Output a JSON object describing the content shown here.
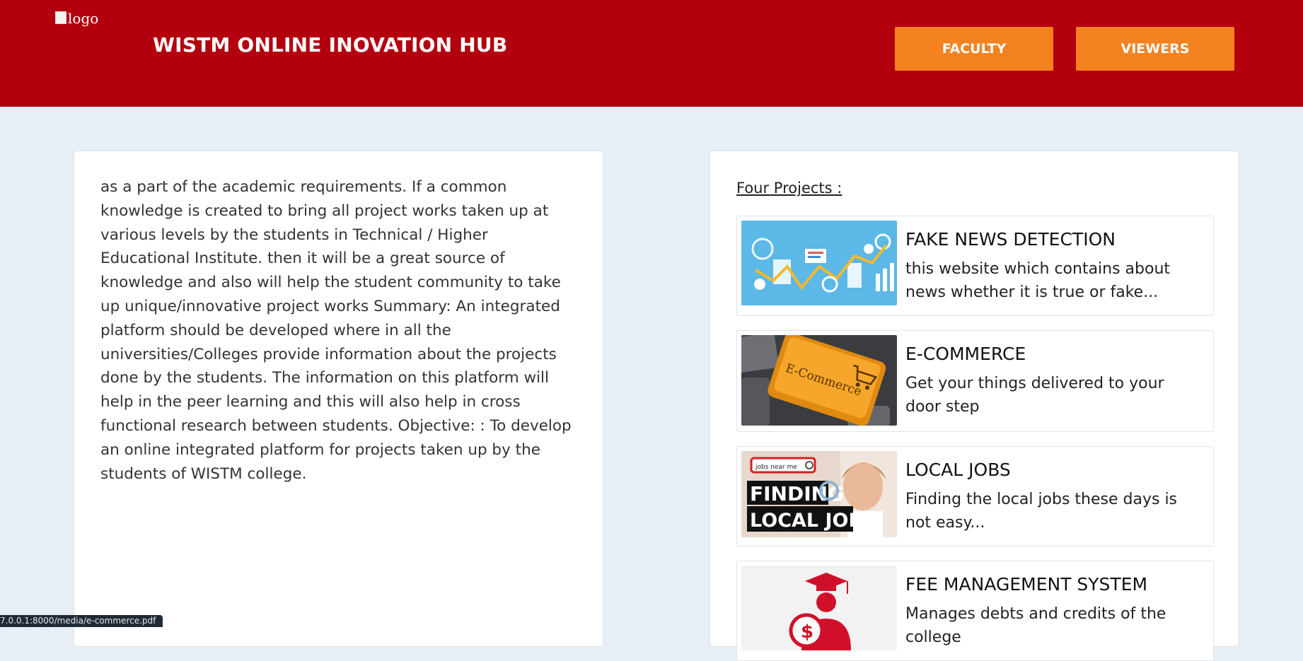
{
  "header": {
    "logo_alt": "logo",
    "title": "WISTM ONLINE INOVATION HUB",
    "nav": [
      {
        "label": "FACULTY"
      },
      {
        "label": "VIEWERS"
      }
    ],
    "bg_color": "#b3000f",
    "button_color": "#f58220"
  },
  "intro": {
    "text": "as a part of the academic requirements. If a common knowledge is created to bring all project works taken up at various levels by the students in Technical / Higher Educational Institute. then it will be a great source of knowledge and also will help the student community to take up unique/innovative project works Summary: An integrated platform should be developed where in all the universities/Colleges provide information about the projects done by the students. The information on this platform will help in the peer learning and this will also help in cross functional research between students. Objective: : To develop an online integrated platform for projects taken up by the students of WISTM college."
  },
  "projects": {
    "heading": "Four Projects :",
    "items": [
      {
        "title": "FAKE NEWS DETECTION",
        "desc": "this website which contains about news whether it is true or fake...",
        "image_icon": "analytics-infographic-image"
      },
      {
        "title": "E-COMMERCE",
        "desc": "Get your things delivered to your door step",
        "image_icon": "ecommerce-keyboard-image",
        "image_text": "E-Commerce"
      },
      {
        "title": "LOCAL JOBS",
        "desc": "Finding the local jobs these days is not easy...",
        "image_icon": "finding-local-jobs-image",
        "image_text_1": "jobs near me",
        "image_text_2": "FINDING",
        "image_text_3": "LOCAL JOBS"
      },
      {
        "title": "FEE MANAGEMENT SYSTEM",
        "desc": "Manages debts and credits of the college",
        "image_icon": "graduate-fees-image"
      }
    ]
  },
  "status_bar": {
    "url": "7.0.0.1:8000/media/e-commerce.pdf"
  }
}
